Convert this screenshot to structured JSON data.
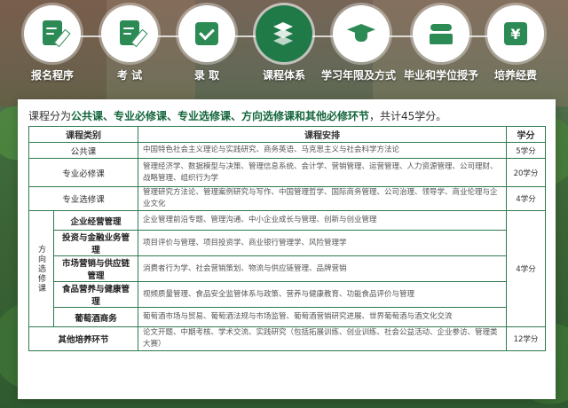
{
  "nav": {
    "items": [
      {
        "label": "报名程序",
        "icon": "application-document-icon",
        "active": false
      },
      {
        "label": "考 试",
        "icon": "exam-pen-icon",
        "active": false
      },
      {
        "label": "录 取",
        "icon": "admission-check-icon",
        "active": false
      },
      {
        "label": "课程体系",
        "icon": "layers-icon",
        "active": true
      },
      {
        "label": "学习年限及方式",
        "icon": "graduation-cap-icon",
        "active": false
      },
      {
        "label": "毕业和学位授予",
        "icon": "diploma-icon",
        "active": false
      },
      {
        "label": "培养经费",
        "icon": "money-yuan-icon",
        "active": false
      }
    ]
  },
  "intro": {
    "prefix": "课程分为",
    "highlight": "公共课、专业必修课、专业选修课、方向选修课和其他必修环节",
    "suffix": "，共计45学分。"
  },
  "table": {
    "headers": [
      "课程类别",
      "课程安排",
      "学分"
    ],
    "rows": {
      "public": {
        "category": "公共课",
        "arrangement": "中国特色社会主义理论与实践研究、商务英语、马克思主义与社会科学方法论",
        "credit": "5学分"
      },
      "required": {
        "category": "专业必修课",
        "arrangement": "管理经济学、数据模型与决策、管理信息系统、会计学、营销管理、运营管理、人力资源管理、公司理财、战略管理、组织行为学",
        "credit": "20学分"
      },
      "elective": {
        "category": "专业选修课",
        "arrangement": "管理研究方法论、管理案例研究与写作、中国管理哲学、国际商务管理、公司治理、领导学、商业伦理与企业文化",
        "credit": "4学分"
      },
      "direction": {
        "group_label": "方向选修课",
        "credit": "4学分",
        "items": [
          {
            "category": "企业经营管理",
            "arrangement": "企业管理前沿专题、管理沟通、中小企业成长与管理、创新与创业管理"
          },
          {
            "category": "投资与金融业务管理",
            "arrangement": "项目评价与管理、项目投资学、商业银行管理学、风险管理学"
          },
          {
            "category": "市场营销与供应链管理",
            "arrangement": "消费者行为学、社会营销策划、物流与供应链管理、品牌营销"
          },
          {
            "category": "食品营养与健康管理",
            "arrangement": "视频质量管理、食品安全监管体系与政策、营养与健康教育、功能食品评价与管理"
          },
          {
            "category": "葡萄酒商务",
            "arrangement": "葡萄酒市场与贸易、葡萄酒法规与市场监管、葡萄酒营销研究进展、世界葡萄酒与酒文化交流"
          }
        ]
      },
      "other": {
        "category": "其他培养环节",
        "arrangement": "论文开题、中期考核、学术交流、实践研究（包括拓展训练、创业训练、社会公益活动、企业参访、管理类大赛）",
        "credit": "12学分"
      }
    }
  },
  "colors": {
    "accent": "#14663c",
    "border": "#2f7a4d",
    "active_nav": "#1f7a48"
  }
}
